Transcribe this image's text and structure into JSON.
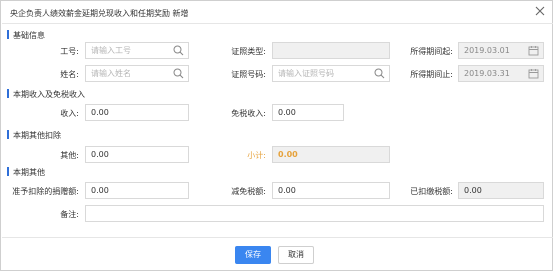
{
  "dialog": {
    "title": "央企负责人绩效薪金延期兑现收入和任期奖励 新增"
  },
  "sections": {
    "basic": "基础信息",
    "income": "本期收入及免税收入",
    "deduction": "本期其他扣除",
    "other": "本期其他"
  },
  "basic": {
    "job_no_label": "工号:",
    "job_no_placeholder": "请输入工号",
    "name_label": "姓名:",
    "name_placeholder": "请输入姓名",
    "id_type_label": "证照类型:",
    "id_no_label": "证照号码:",
    "id_no_placeholder": "请输入证照号码",
    "period_start_label": "所得期间起:",
    "period_start_value": "2019.03.01",
    "period_end_label": "所得期间止:",
    "period_end_value": "2019.03.31"
  },
  "income": {
    "income_label": "收入:",
    "income_value": "0.00",
    "taxfree_label": "免税收入:",
    "taxfree_value": "0.00"
  },
  "deduction": {
    "other_label": "其他:",
    "other_value": "0.00",
    "subtotal_label": "小计:",
    "subtotal_value": "0.00"
  },
  "other": {
    "donation_label": "准予扣除的捐赠额:",
    "donation_value": "0.00",
    "tax_reduction_label": "减免税额:",
    "tax_reduction_value": "0.00",
    "withheld_label": "已扣缴税额:",
    "withheld_value": "0.00",
    "remark_label": "备注:",
    "remark_value": ""
  },
  "footer": {
    "save_label": "保存",
    "cancel_label": "取消"
  },
  "colors": {
    "accent": "#3a86f0",
    "section_bar": "#2f6fd8",
    "subtotal": "#e6a23c"
  },
  "icons": [
    "close-icon",
    "search-icon",
    "calendar-icon"
  ]
}
